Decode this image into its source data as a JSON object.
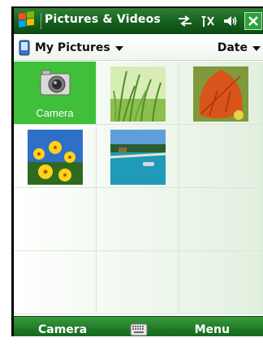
{
  "titlebar": {
    "title": "Pictures & Videos",
    "icons": [
      "windows-start-icon",
      "connectivity-icon",
      "signal-icon",
      "volume-icon",
      "close-icon"
    ]
  },
  "subheader": {
    "folder_label": "My Pictures",
    "sort_label": "Date"
  },
  "grid": {
    "items": [
      {
        "type": "camera",
        "label": "Camera",
        "selected": true
      },
      {
        "type": "photo",
        "subject": "grass"
      },
      {
        "type": "photo",
        "subject": "autumn-leaf"
      },
      {
        "type": "photo",
        "subject": "yellow-flowers"
      },
      {
        "type": "photo",
        "subject": "pool-beach"
      }
    ],
    "rows": 4,
    "columns": 3
  },
  "softkeys": {
    "left": "Camera",
    "right": "Menu"
  },
  "colors": {
    "titlebar": "#17601f",
    "selected": "#3fbf3a",
    "softbar": "#1d7424"
  }
}
